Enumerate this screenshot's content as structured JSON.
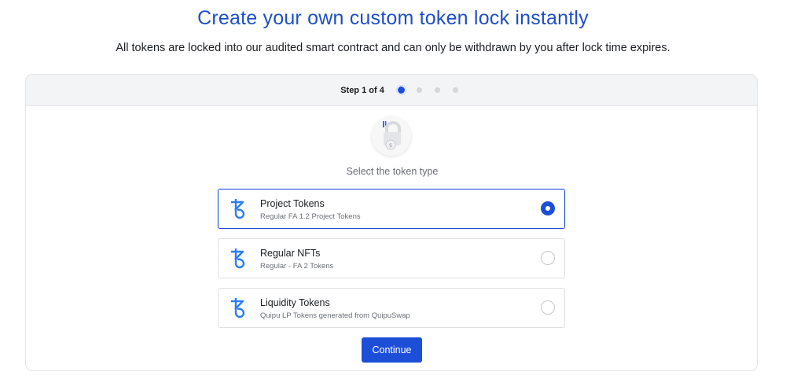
{
  "header": {
    "title": "Create your own custom token lock instantly",
    "subtitle": "All tokens are locked into our audited smart contract and can only be withdrawn by you after lock time expires."
  },
  "wizard": {
    "step_label": "Step 1 of 4",
    "current_step": 1,
    "total_steps": 4,
    "prompt": "Select the token type",
    "options": [
      {
        "title": "Project Tokens",
        "description": "Regular FA 1.2 Project Tokens",
        "selected": true,
        "icon": "tezos-icon"
      },
      {
        "title": "Regular NFTs",
        "description": "Regular - FA 2 Tokens",
        "selected": false,
        "icon": "tezos-icon"
      },
      {
        "title": "Liquidity Tokens",
        "description": "Quipu LP Tokens generated from QuipuSwap",
        "selected": false,
        "icon": "tezos-icon"
      }
    ],
    "continue_label": "Continue"
  },
  "colors": {
    "accent": "#1d4ed8",
    "title": "#1f4fc8",
    "tezos_icon": "#2c7df7"
  }
}
